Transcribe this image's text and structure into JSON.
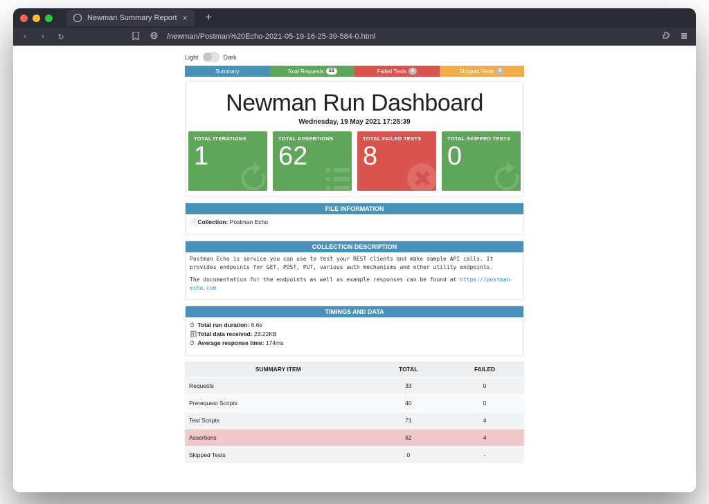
{
  "browser": {
    "tab_title": "Newman Summary Report",
    "url": "/newman/Postman%20Echo-2021-05-19-16-25-39-584-0.html"
  },
  "theme": {
    "light": "Light",
    "dark": "Dark"
  },
  "nav": {
    "summary": "Summary",
    "total_requests": "Total Requests",
    "total_requests_badge": "33",
    "failed_tests": "Failed Tests",
    "failed_tests_badge": "0",
    "skipped_tests": "Skipped Tests",
    "skipped_tests_badge": "0"
  },
  "header": {
    "title": "Newman Run Dashboard",
    "timestamp": "Wednesday, 19 May 2021 17:25:39"
  },
  "cards": {
    "iterations": {
      "label": "TOTAL ITERATIONS",
      "value": "1"
    },
    "assertions": {
      "label": "TOTAL ASSERTIONS",
      "value": "62"
    },
    "failed": {
      "label": "TOTAL FAILED TESTS",
      "value": "8"
    },
    "skipped": {
      "label": "TOTAL SKIPPED TESTS",
      "value": "0"
    }
  },
  "file_info": {
    "heading": "FILE INFORMATION",
    "collection_label": "Collection:",
    "collection_name": "Postman Echo"
  },
  "description": {
    "heading": "COLLECTION DESCRIPTION",
    "p1a": "Postman Echo is service you can use to test your REST clients and make sample API calls. It provides endpoints for ",
    "p1b": "GET",
    "p1c": ", ",
    "p1d": "POST",
    "p1e": ", ",
    "p1f": "PUT",
    "p1g": ", various auth mechanisms and other utility endpoints.",
    "p2a": "The documentation for the endpoints as well as example responses can be found at ",
    "link_text": "https://postman-echo.com"
  },
  "timings": {
    "heading": "TIMINGS AND DATA",
    "run_duration_label": "Total run duration:",
    "run_duration_value": "6.6s",
    "data_received_label": "Total data received:",
    "data_received_value": "23.22KB",
    "avg_response_label": "Average response time:",
    "avg_response_value": "174ms"
  },
  "table": {
    "headers": {
      "item": "SUMMARY ITEM",
      "total": "TOTAL",
      "failed": "FAILED"
    },
    "rows": {
      "requests": {
        "item": "Requests",
        "total": "33",
        "failed": "0"
      },
      "prerequest": {
        "item": "Prerequest Scripts",
        "total": "40",
        "failed": "0"
      },
      "testscripts": {
        "item": "Test Scripts",
        "total": "71",
        "failed": "4"
      },
      "assertions": {
        "item": "Assertions",
        "total": "62",
        "failed": "4"
      },
      "skipped": {
        "item": "Skipped Tests",
        "total": "0",
        "failed": "-"
      }
    }
  }
}
